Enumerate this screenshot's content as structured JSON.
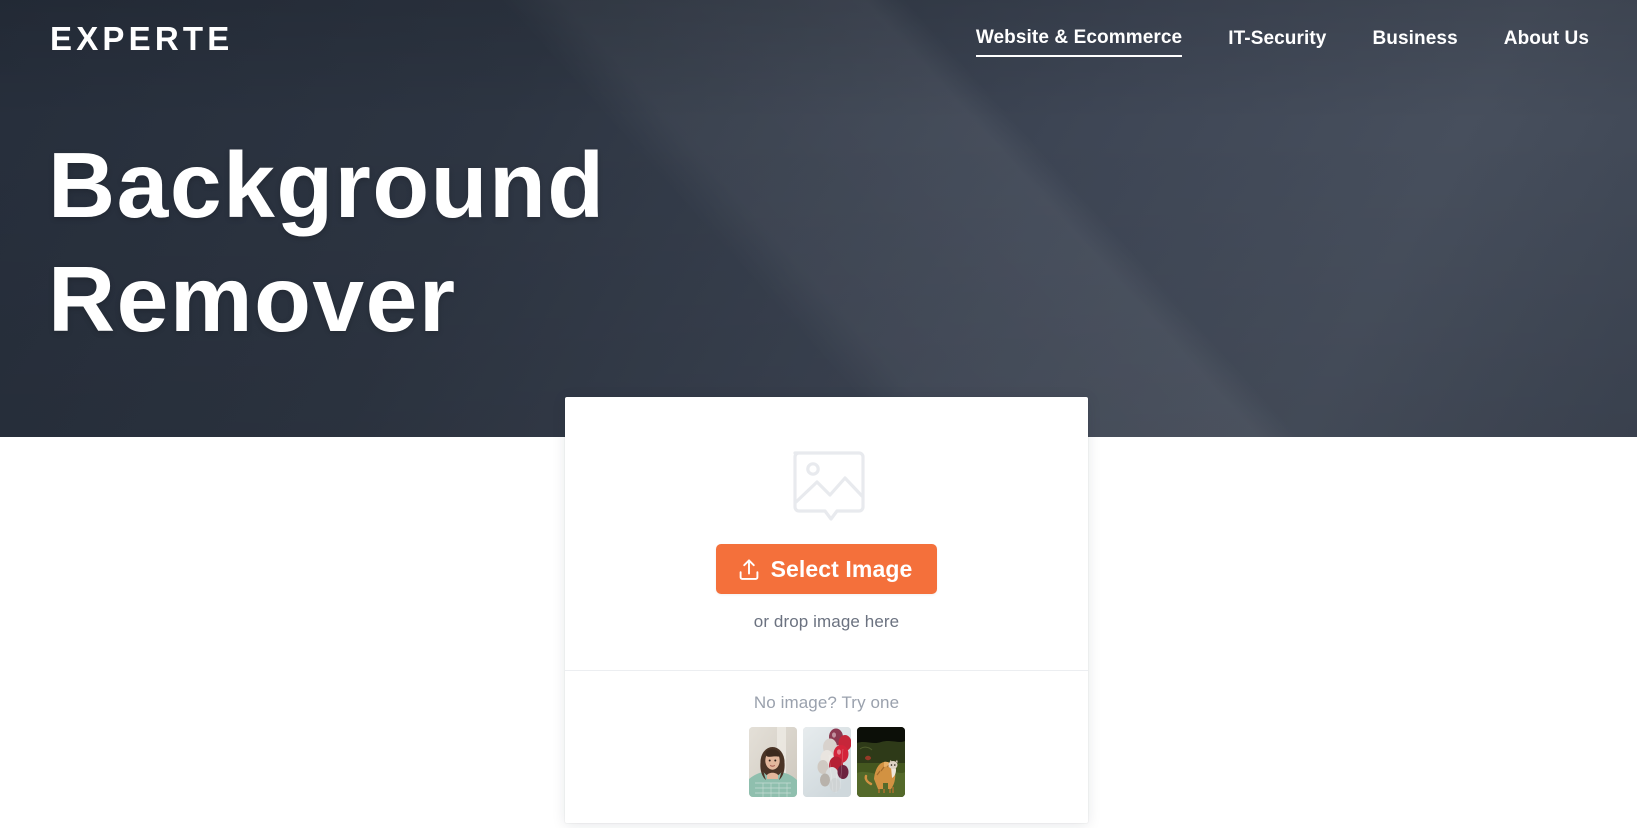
{
  "brand": {
    "logo": "EXPERTE"
  },
  "nav": {
    "items": [
      {
        "label": "Website & Ecommerce",
        "active": true
      },
      {
        "label": "IT-Security",
        "active": false
      },
      {
        "label": "Business",
        "active": false
      },
      {
        "label": "About Us",
        "active": false
      }
    ]
  },
  "hero": {
    "title_line1": "Background",
    "title_line2": "Remover",
    "bg_dark": "#2d3542",
    "bg_light": "#474f5d"
  },
  "upload": {
    "placeholder_icon": "image-placeholder-icon",
    "button_icon": "upload-icon",
    "button_label": "Select Image",
    "button_color": "#f4703b",
    "drop_hint": "or drop image here"
  },
  "samples": {
    "label": "No image? Try one",
    "items": [
      {
        "name": "sample-woman-portrait",
        "alt": "woman with curly hair in green plaid shirt"
      },
      {
        "name": "sample-balloons",
        "alt": "cluster of red, white and blue balloons"
      },
      {
        "name": "sample-tiger",
        "alt": "tiger standing on green grass"
      }
    ]
  }
}
